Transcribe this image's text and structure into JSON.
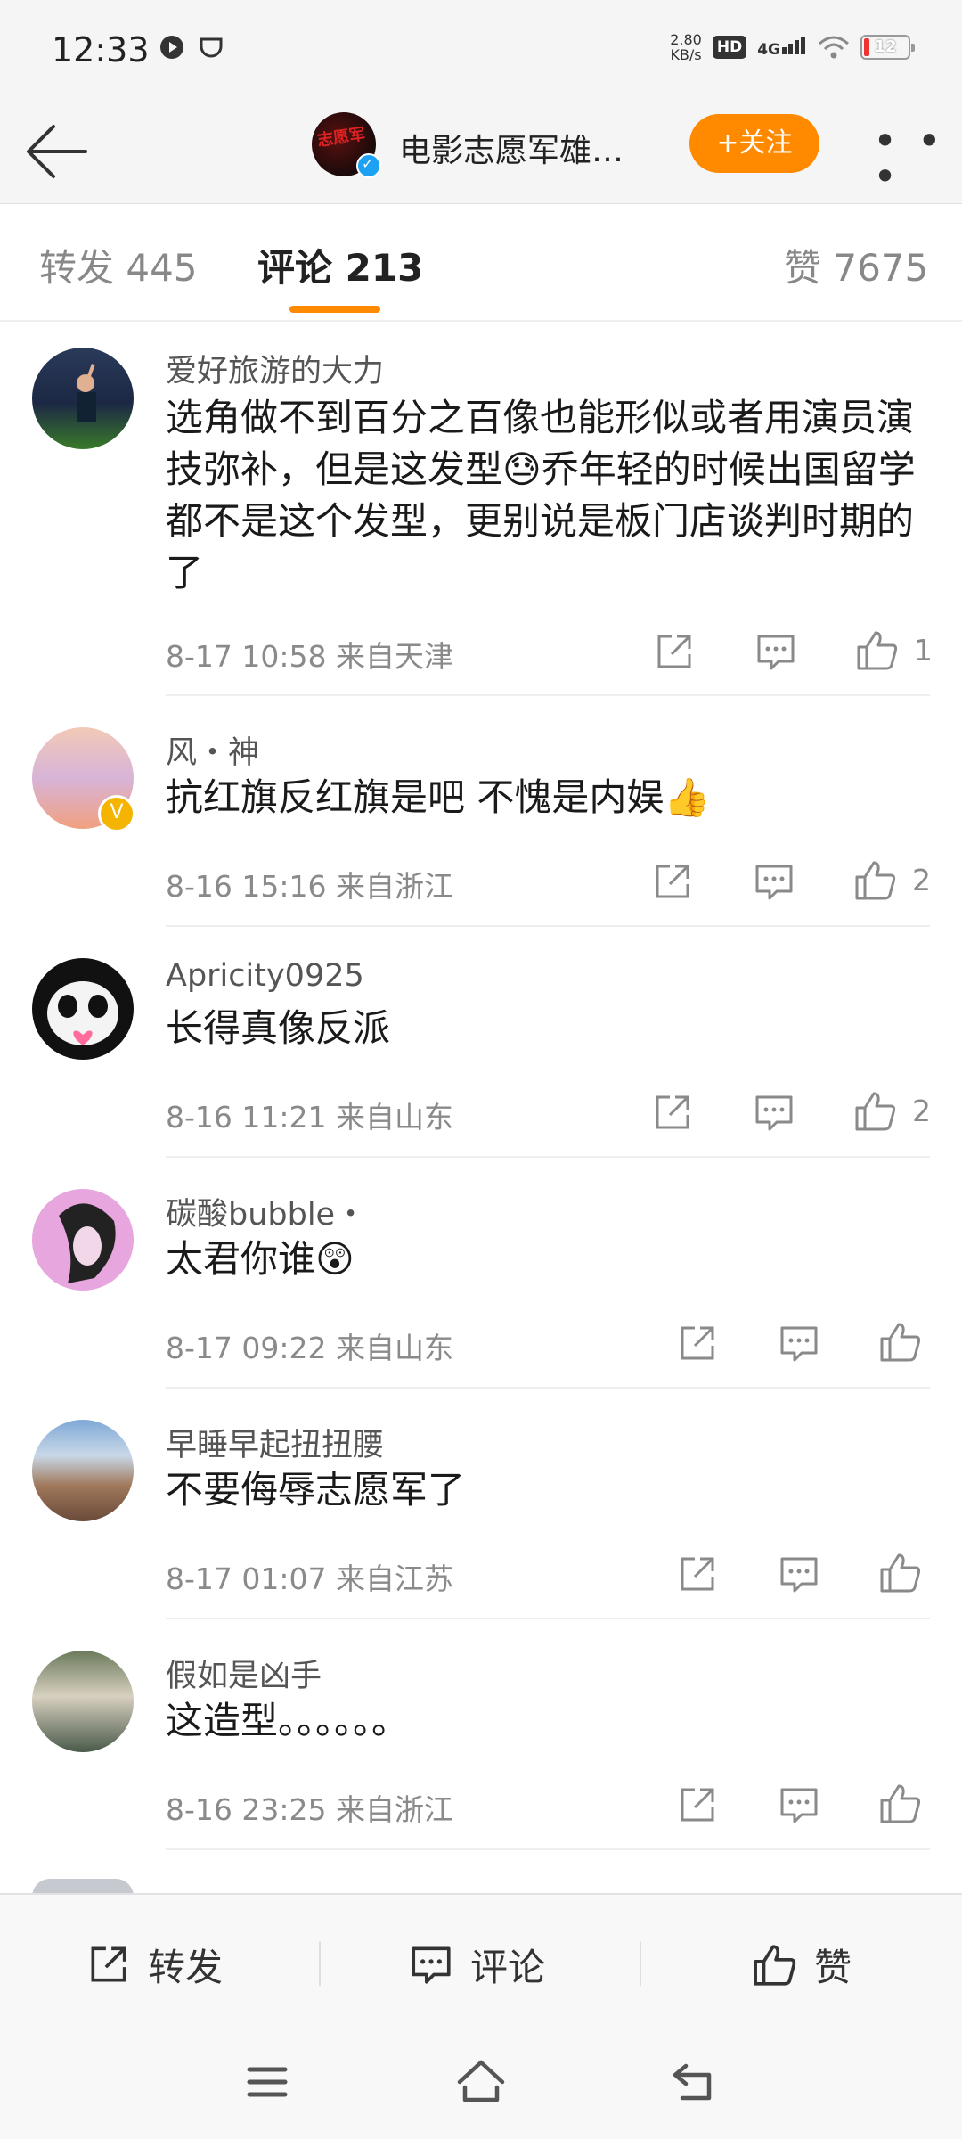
{
  "status_bar": {
    "time": "12:33",
    "speed_value": "2.80",
    "speed_unit": "KB/s",
    "hd": "HD",
    "network": "4G",
    "battery": "12"
  },
  "header": {
    "account_name": "电影志愿军雄…",
    "follow_label": "+关注",
    "more_label": "• • •",
    "avatar_text": "志愿军"
  },
  "tabs": {
    "repost": "转发 445",
    "comment": "评论 213",
    "like": "赞 7675"
  },
  "comments": [
    {
      "user": "爱好旅游的大力",
      "text": "选角做不到百分之百像也能形似或者用演员演技弥补，但是这发型😓乔年轻的时候出国留学都不是这个发型，更别说是板门店谈判时期的了",
      "meta": "8-17 10:58  来自天津",
      "likes": "1"
    },
    {
      "user": "风・神",
      "text": "抗红旗反红旗是吧 不愧是内娱👍",
      "meta": "8-16 15:16  来自浙江",
      "likes": "2"
    },
    {
      "user": "Apricity0925",
      "text": "长得真像反派",
      "meta": "8-16 11:21  来自山东",
      "likes": "2"
    },
    {
      "user": "碳酸bubble・",
      "text": "太君你谁😲",
      "meta": "8-17 09:22  来自山东",
      "likes": ""
    },
    {
      "user": "早睡早起扭扭腰",
      "text": "不要侮辱志愿军了",
      "meta": "8-17 01:07  来自江苏",
      "likes": ""
    },
    {
      "user": "假如是凶手",
      "text": "这造型。。。。。。",
      "meta": "8-16 23:25  来自浙江",
      "likes": ""
    }
  ],
  "action_bar": {
    "repost": "转发",
    "comment": "评论",
    "like": "赞"
  },
  "colors": {
    "accent": "#ff8a00",
    "text": "#1a1a1a",
    "muted": "#8a8a8a"
  }
}
